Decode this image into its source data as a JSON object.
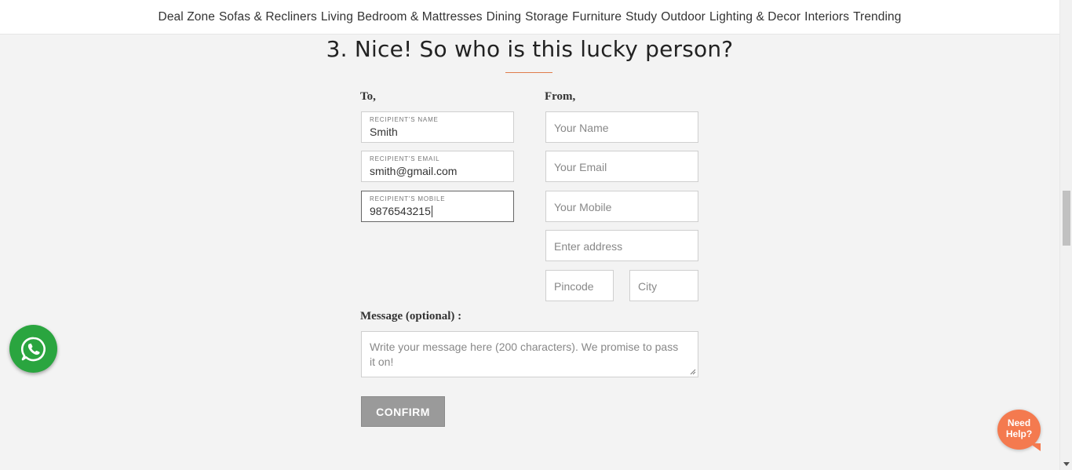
{
  "nav": {
    "items": [
      "Deal Zone",
      "Sofas & Recliners",
      "Living",
      "Bedroom & Mattresses",
      "Dining",
      "Storage",
      "Furniture",
      "Study",
      "Outdoor",
      "Lighting & Decor",
      "Interiors",
      "Trending"
    ]
  },
  "form": {
    "heading": "3. Nice! So who is this lucky person?",
    "to_label": "To,",
    "from_label": "From,",
    "recipient": {
      "name_label": "RECIPIENT'S NAME",
      "name_value": "Smith",
      "email_label": "RECIPIENT'S EMAIL",
      "email_value": "smith@gmail.com",
      "mobile_label": "RECIPIENT'S MOBILE",
      "mobile_value": "9876543215"
    },
    "sender": {
      "name_placeholder": "Your Name",
      "email_placeholder": "Your Email",
      "mobile_placeholder": "Your Mobile",
      "address_placeholder": "Enter address",
      "pincode_placeholder": "Pincode",
      "city_placeholder": "City"
    },
    "message_label": "Message (optional) :",
    "message_placeholder": "Write your message here (200 characters). We promise to pass it on!",
    "confirm_label": "CONFIRM"
  },
  "widgets": {
    "need_help_line1": "Need",
    "need_help_line2": "Help?",
    "whatsapp_icon": "whatsapp-icon"
  },
  "colors": {
    "accent": "#e07b4b",
    "whatsapp": "#2aa53f",
    "help_bubble": "#f47a4f",
    "confirm_button": "#9a9a9a"
  }
}
